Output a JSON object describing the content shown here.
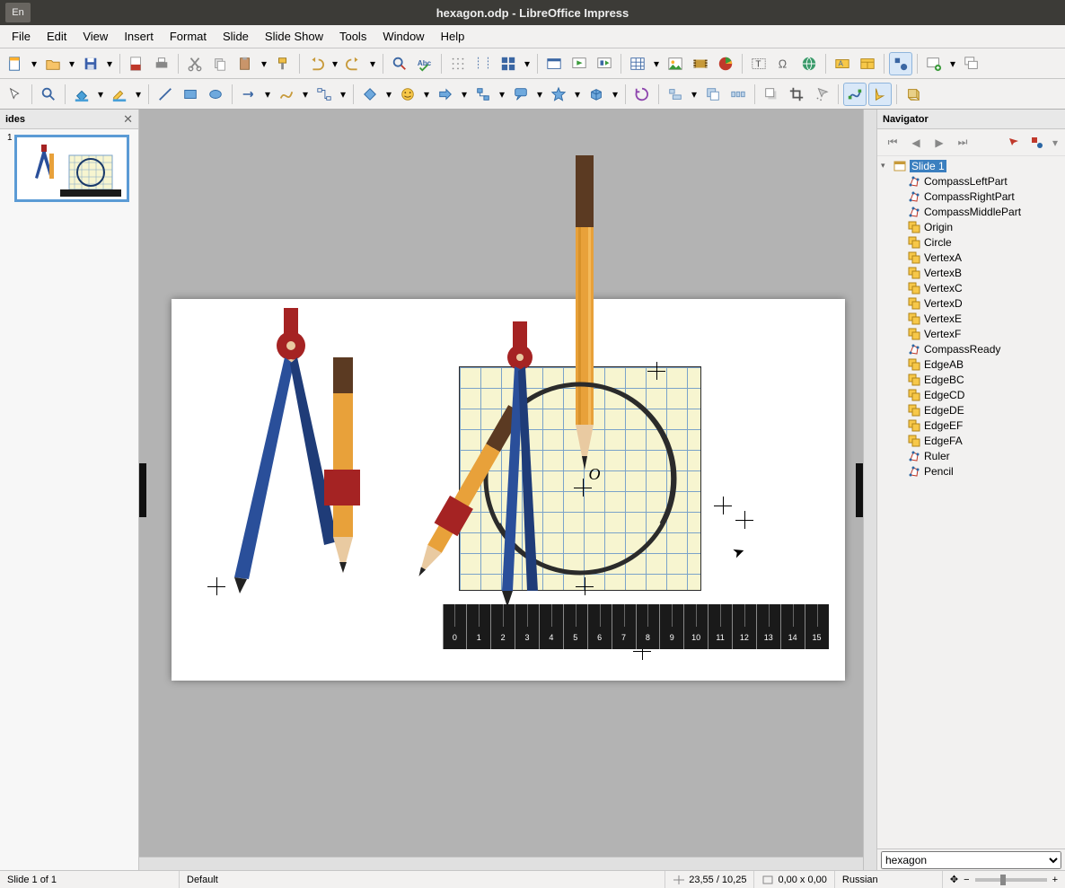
{
  "titlebar": {
    "lang": "En",
    "title": "hexagon.odp - LibreOffice Impress"
  },
  "menu": [
    "File",
    "Edit",
    "View",
    "Insert",
    "Format",
    "Slide",
    "Slide Show",
    "Tools",
    "Window",
    "Help"
  ],
  "slides_panel": {
    "title": "ides",
    "slide_number": "1"
  },
  "navigator": {
    "title": "Navigator",
    "root": "Slide 1",
    "items": [
      {
        "label": "CompassLeftPart",
        "icon": "polygon"
      },
      {
        "label": "CompassRightPart",
        "icon": "polygon"
      },
      {
        "label": "CompassMiddlePart",
        "icon": "polygon"
      },
      {
        "label": "Origin",
        "icon": "group"
      },
      {
        "label": "Circle",
        "icon": "group"
      },
      {
        "label": "VertexA",
        "icon": "group"
      },
      {
        "label": "VertexB",
        "icon": "group"
      },
      {
        "label": "VertexC",
        "icon": "group"
      },
      {
        "label": "VertexD",
        "icon": "group"
      },
      {
        "label": "VertexE",
        "icon": "group"
      },
      {
        "label": "VertexF",
        "icon": "group"
      },
      {
        "label": "CompassReady",
        "icon": "polygon"
      },
      {
        "label": "EdgeAB",
        "icon": "group"
      },
      {
        "label": "EdgeBC",
        "icon": "group"
      },
      {
        "label": "EdgeCD",
        "icon": "group"
      },
      {
        "label": "EdgeDE",
        "icon": "group"
      },
      {
        "label": "EdgeEF",
        "icon": "group"
      },
      {
        "label": "EdgeFA",
        "icon": "group"
      },
      {
        "label": "Ruler",
        "icon": "polygon"
      },
      {
        "label": "Pencil",
        "icon": "polygon"
      }
    ],
    "doc": "hexagon"
  },
  "status": {
    "slide_info": "Slide 1 of 1",
    "master": "Default",
    "coords": "23,55 / 10,25",
    "size": "0,00 x 0,00",
    "language": "Russian"
  },
  "canvas": {
    "center_label": "O",
    "ruler_numbers": [
      "0",
      "1",
      "2",
      "3",
      "4",
      "5",
      "6",
      "7",
      "8",
      "9",
      "10",
      "11",
      "12",
      "13",
      "14",
      "15"
    ]
  }
}
